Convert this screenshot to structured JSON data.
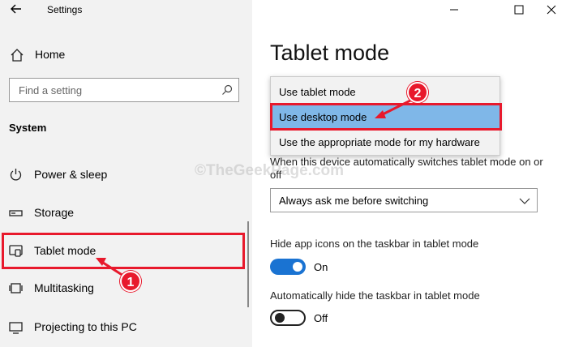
{
  "window": {
    "title": "Settings",
    "back_icon": "back-arrow-icon",
    "controls": [
      "minimize-icon",
      "maximize-icon",
      "close-icon"
    ]
  },
  "sidebar": {
    "home_label": "Home",
    "search_placeholder": "Find a setting",
    "section": "System",
    "items": [
      {
        "label": "Power & sleep",
        "icon": "power-icon"
      },
      {
        "label": "Storage",
        "icon": "storage-icon"
      },
      {
        "label": "Tablet mode",
        "icon": "tablet-mode-icon"
      },
      {
        "label": "Multitasking",
        "icon": "multitasking-icon"
      },
      {
        "label": "Projecting to this PC",
        "icon": "projecting-icon"
      }
    ]
  },
  "main": {
    "page_title": "Tablet mode",
    "signin_dropdown": {
      "options": [
        "Use tablet mode",
        "Use desktop mode",
        "Use the appropriate mode for my hardware"
      ],
      "highlighted": "Use desktop mode"
    },
    "switch_desc": "When this device automatically switches tablet mode on or off",
    "switch_select_value": "Always ask me before switching",
    "hide_icons_label": "Hide app icons on the taskbar in tablet mode",
    "hide_icons_state": "On",
    "auto_hide_label": "Automatically hide the taskbar in tablet mode",
    "auto_hide_state": "Off"
  },
  "watermark": "©TheGeekPage.com",
  "callouts": {
    "one": "1",
    "two": "2"
  },
  "colors": {
    "accent": "#1a73d2",
    "highlight": "#e8192c",
    "selected_option": "#7fb7e8"
  }
}
